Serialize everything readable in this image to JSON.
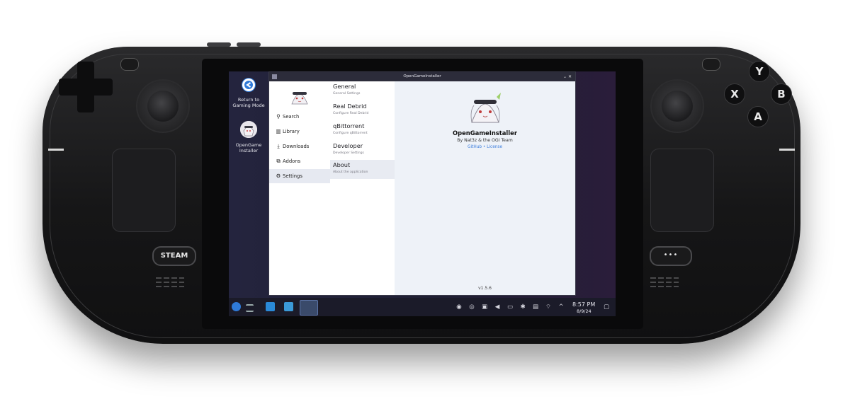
{
  "device": {
    "steam_button_label": "STEAM",
    "menu_button_label": "•••",
    "face_buttons": {
      "y": "Y",
      "x": "X",
      "b": "B",
      "a": "A"
    }
  },
  "desktop": {
    "return_label": "Return to Gaming Mode",
    "app_label": "OpenGame Installer"
  },
  "window": {
    "title": "OpenGameInstaller",
    "controls": "⌄  ✕"
  },
  "nav": {
    "items": [
      {
        "label": "Search",
        "icon": "search-icon"
      },
      {
        "label": "Library",
        "icon": "library-icon"
      },
      {
        "label": "Downloads",
        "icon": "download-icon"
      },
      {
        "label": "Addons",
        "icon": "puzzle-icon"
      },
      {
        "label": "Settings",
        "icon": "gear-icon",
        "active": true
      }
    ]
  },
  "settings": {
    "items": [
      {
        "title": "General",
        "subtitle": "General Settings"
      },
      {
        "title": "Real Debrid",
        "subtitle": "Configure Real Debrid"
      },
      {
        "title": "qBittorrent",
        "subtitle": "Configure qBittorrent"
      },
      {
        "title": "Developer",
        "subtitle": "Developer Settings"
      },
      {
        "title": "About",
        "subtitle": "About the application",
        "active": true
      }
    ]
  },
  "about": {
    "app_name": "OpenGameInstaller",
    "byline": "By Nat3z & the OGI Team",
    "links": "GitHub • License",
    "version": "v1.5.6"
  },
  "taskbar": {
    "time": "8:57 PM",
    "date": "8/9/24"
  },
  "colors": {
    "accent": "#3c7ddc",
    "active_row": "#e8ebf2",
    "content_bg": "#eef2f8"
  }
}
